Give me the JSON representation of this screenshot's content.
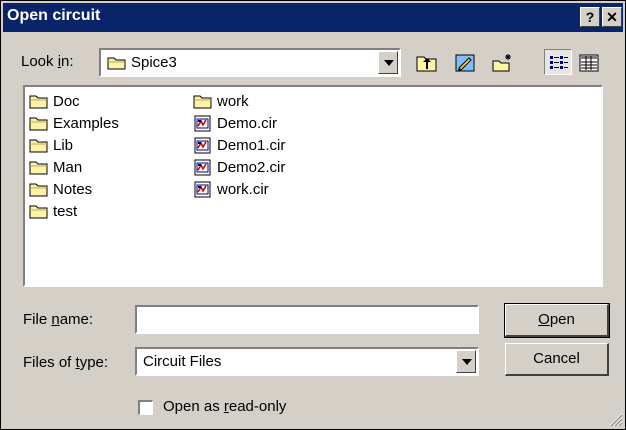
{
  "window": {
    "title": "Open circuit",
    "help_label": "?",
    "close_label": "✕"
  },
  "lookin": {
    "label_prefix": "Look ",
    "label_accel": "i",
    "label_suffix": "n:",
    "value": "Spice3",
    "icon": "folder-icon"
  },
  "toolbar": {
    "buttons": [
      "up-one-level",
      "desktop",
      "create-new-folder",
      "list-view",
      "details-view"
    ]
  },
  "files": {
    "column1": [
      {
        "name": "Doc",
        "icon": "folder-icon"
      },
      {
        "name": "Examples",
        "icon": "folder-icon"
      },
      {
        "name": "Lib",
        "icon": "folder-icon"
      },
      {
        "name": "Man",
        "icon": "folder-icon"
      },
      {
        "name": "Notes",
        "icon": "folder-icon"
      },
      {
        "name": "test",
        "icon": "folder-icon"
      }
    ],
    "column2": [
      {
        "name": "work",
        "icon": "folder-icon"
      },
      {
        "name": "Demo.cir",
        "icon": "circuit-file-icon"
      },
      {
        "name": "Demo1.cir",
        "icon": "circuit-file-icon"
      },
      {
        "name": "Demo2.cir",
        "icon": "circuit-file-icon"
      },
      {
        "name": "work.cir",
        "icon": "circuit-file-icon"
      }
    ]
  },
  "filename": {
    "label_prefix": "File ",
    "label_accel": "n",
    "label_suffix": "ame:",
    "value": ""
  },
  "filetype": {
    "label_prefix": "Files of ",
    "label_accel": "t",
    "label_suffix": "ype:",
    "value": "Circuit Files"
  },
  "buttons": {
    "open_accel": "O",
    "open_rest": "pen",
    "cancel": "Cancel"
  },
  "readonly": {
    "label_prefix": "Open as ",
    "label_accel": "r",
    "label_suffix": "ead-only",
    "checked": false
  },
  "colors": {
    "titlebar": "#0a246a",
    "face": "#d4d0c8",
    "folder": "#fff3a8"
  }
}
